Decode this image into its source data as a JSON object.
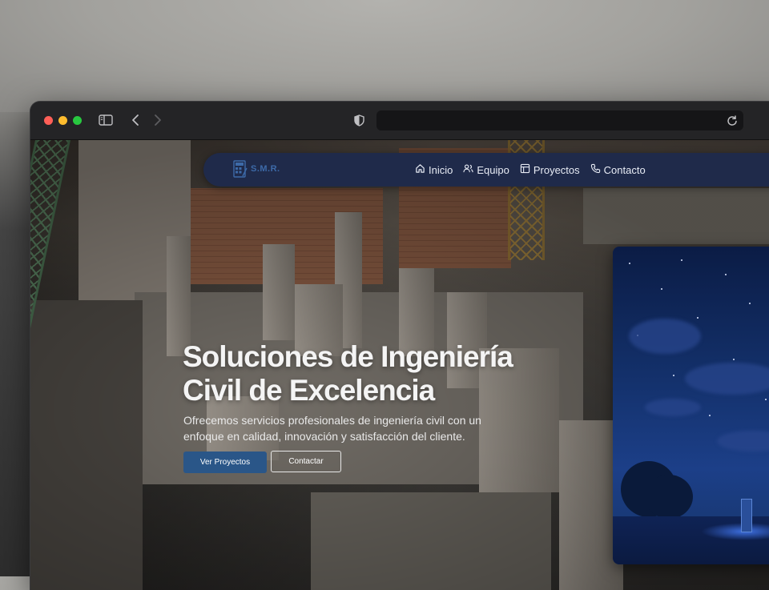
{
  "browser": {
    "url": "",
    "colors": {
      "traffic_red": "#ff5f57",
      "traffic_yellow": "#febc2e",
      "traffic_green": "#28c840"
    }
  },
  "nav": {
    "logo_text": "S.M.R.",
    "items": [
      {
        "label": "Inicio",
        "icon": "home-icon"
      },
      {
        "label": "Equipo",
        "icon": "users-icon"
      },
      {
        "label": "Proyectos",
        "icon": "layout-icon"
      },
      {
        "label": "Contacto",
        "icon": "phone-icon"
      }
    ],
    "bg_color": "#1f2a4a"
  },
  "hero": {
    "title_line1": "Soluciones de Ingeniería",
    "title_line2": "Civil de Excelencia",
    "subtitle_line1": "Ofrecemos servicios profesionales de ingeniería civil con un",
    "subtitle_line2": "enfoque en calidad, innovación y satisfacción del cliente.",
    "primary_button": "Ver Proyectos",
    "secondary_button": "Contactar",
    "accent_color": "#2a5688"
  }
}
